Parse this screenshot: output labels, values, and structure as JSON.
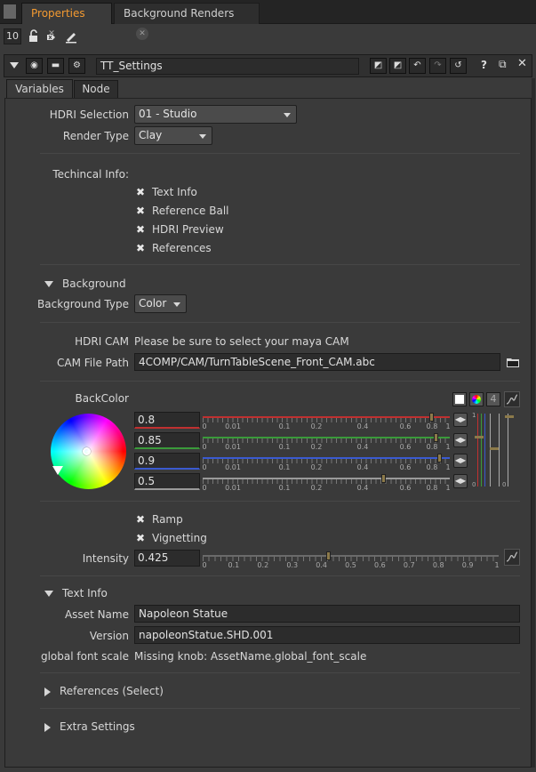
{
  "tabs": [
    {
      "label": "Properties",
      "active": true
    },
    {
      "label": "Background Renders",
      "active": false
    }
  ],
  "toolbar": {
    "max_panels": "10",
    "lock_icon": "lock-icon",
    "clear_icon": "clear-icon",
    "pencil_icon": "pencil-icon"
  },
  "node": {
    "name": "TT_Settings",
    "help": "?"
  },
  "subtabs": [
    {
      "label": "Variables",
      "active": true
    },
    {
      "label": "Node",
      "active": false
    }
  ],
  "hdri": {
    "label": "HDRI Selection",
    "value": "01 - Studio"
  },
  "render_type": {
    "label": "Render Type",
    "value": "Clay"
  },
  "technical": {
    "label": "Techincal Info:",
    "items": [
      "Text Info",
      "Reference Ball",
      "HDRI Preview",
      "References"
    ]
  },
  "background": {
    "section": "Background",
    "type_label": "Background Type",
    "type_value": "Color",
    "hdri_cam_label": "HDRI CAM",
    "hdri_cam_text": "Please be sure to select your maya CAM",
    "cam_path_label": "CAM File Path",
    "cam_path_value": "4COMP/CAM/TurnTableScene_Front_CAM.abc",
    "backcolor_label": "BackColor",
    "channel_count": "4",
    "channels": [
      {
        "value": "0.8",
        "color": "#c03030"
      },
      {
        "value": "0.85",
        "color": "#3a9a3a"
      },
      {
        "value": "0.9",
        "color": "#3a5ad0"
      },
      {
        "value": "0.5",
        "color": "#9a9a9a"
      }
    ],
    "ticks": [
      "0",
      "0.01",
      "0.1",
      "0.2",
      "0.4",
      "0.6",
      "0.8",
      "1"
    ],
    "ramp_label": "Ramp",
    "vignetting_label": "Vignetting",
    "intensity_label": "Intensity",
    "intensity_value": "0.425",
    "intensity_ticks": [
      "0",
      "0.1",
      "0.2",
      "0.3",
      "0.4",
      "0.5",
      "0.6",
      "0.7",
      "0.8",
      "0.9",
      "1"
    ]
  },
  "text_info": {
    "section": "Text Info",
    "asset_label": "Asset Name",
    "asset_value": "Napoleon Statue",
    "version_label": "Version",
    "version_value": "napoleonStatue.SHD.001",
    "font_scale_label": "global font scale",
    "font_scale_text": "Missing knob: AssetName.global_font_scale"
  },
  "sections_collapsed": [
    "References (Select)",
    "Extra Settings"
  ],
  "colors": {
    "accent": "#f39a31",
    "panel": "#3a3a3a",
    "field": "#2c2c2c"
  }
}
